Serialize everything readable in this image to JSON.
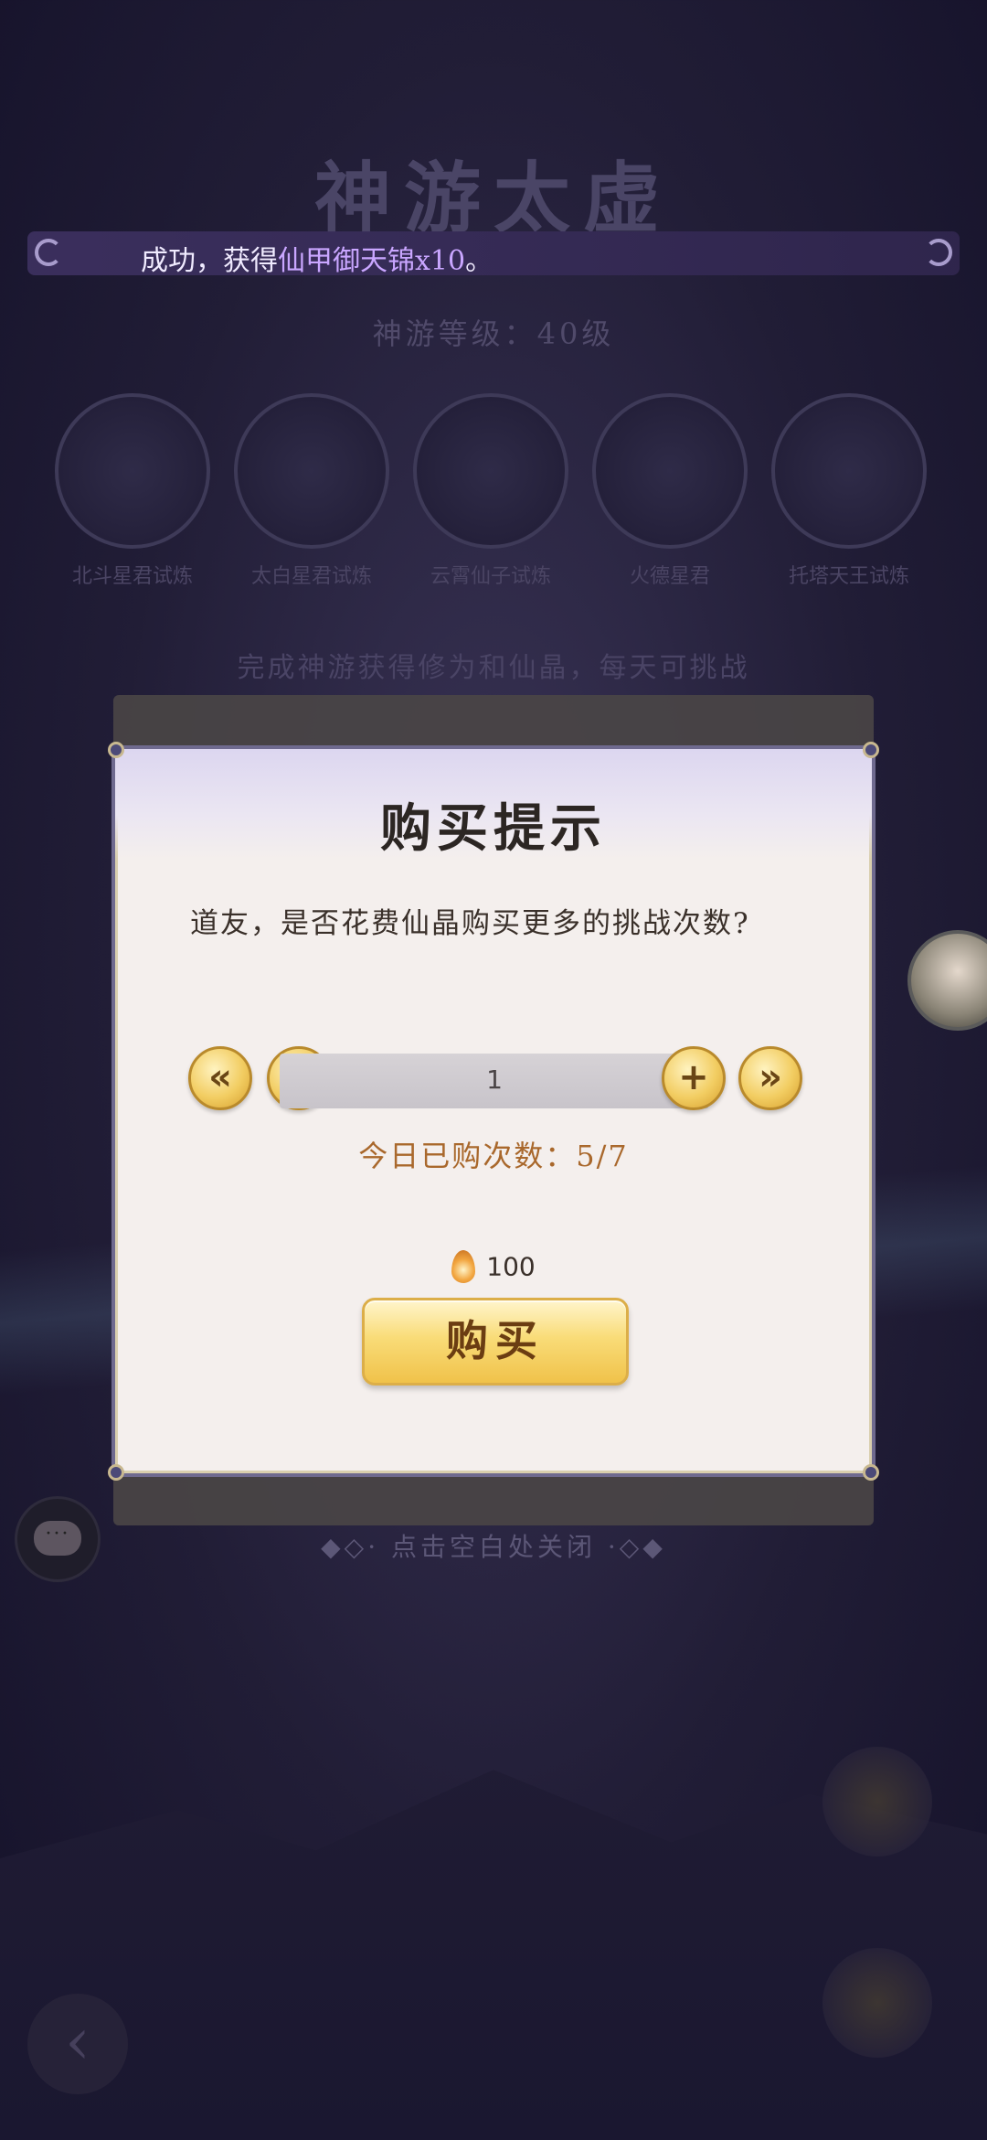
{
  "scene": {
    "title": "神游太虚",
    "sub": "神游等级：40级",
    "orbs": [
      {
        "caption": "北斗星君试炼"
      },
      {
        "caption": "太白星君试炼"
      },
      {
        "caption": "云霄仙子试炼"
      },
      {
        "caption": "火德星君"
      },
      {
        "caption": "托塔天王试炼"
      }
    ],
    "hint": "完成神游获得修为和仙晶，每天可挑战"
  },
  "toast": {
    "prefix": "成功，获得",
    "item": "仙甲御天锦x10",
    "suffix": "。"
  },
  "dialog": {
    "title": "购买提示",
    "question": "道友，是否花费仙晶购买更多的挑战次数?",
    "stepper": {
      "min_label": "«",
      "minus_label": "−",
      "quantity": "1",
      "plus_label": "+",
      "max_label": "»"
    },
    "today_purchased": "今日已购次数：5/7",
    "cost": "100",
    "buy_label": "购买"
  },
  "close_hint": "◆◇· 点击空白处关闭 ·◇◆",
  "chat_label": "···",
  "colors": {
    "accent_gold": "#f0c24a",
    "toast_highlight": "#c9a6ff",
    "today_text": "#a9682c"
  },
  "icons": {
    "cost_icon": "crystal-icon",
    "chat_icon": "chat-icon",
    "back_icon": "back-arrow-icon"
  }
}
